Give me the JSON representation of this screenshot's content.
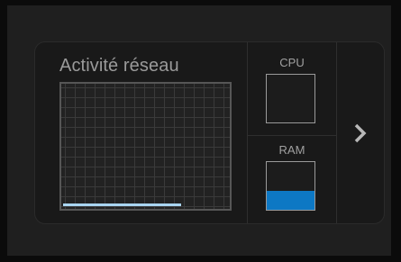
{
  "network": {
    "title": "Activité réseau",
    "traffic_fraction": 0.7
  },
  "cpu": {
    "label": "CPU",
    "usage_fraction": 0.0
  },
  "ram": {
    "label": "RAM",
    "usage_fraction": 0.4
  },
  "colors": {
    "graph_line": "#a9d4f0",
    "meter_fill": "#0d78c4",
    "text": "#9a9a9a"
  },
  "icons": {
    "next": "chevron-right-icon"
  }
}
